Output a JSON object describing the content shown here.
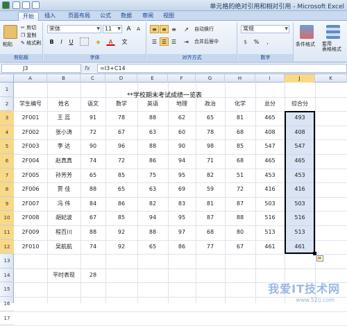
{
  "window": {
    "title": "单元格的绝对引用和相对引用 - Microsoft Excel"
  },
  "ribbon_tabs": [
    "开始",
    "插入",
    "页面布局",
    "公式",
    "数据",
    "审阅",
    "视图"
  ],
  "ribbon": {
    "clipboard": {
      "paste": "粘贴",
      "cut": "剪切",
      "copy": "复制",
      "format_painter": "格式刷",
      "label": "剪贴板"
    },
    "font": {
      "name": "宋体",
      "size": "11",
      "bold": "B",
      "italic": "I",
      "underline": "U",
      "grow": "A",
      "shrink": "A",
      "font_color": "A",
      "wen": "文",
      "label": "字体"
    },
    "alignment": {
      "wrap": "自动换行",
      "merge": "合并后居中",
      "label": "对齐方式"
    },
    "number": {
      "format": "常规",
      "percent": "%",
      "comma": ",",
      "label": "数字"
    },
    "styles": {
      "conditional": "条件格式",
      "table": "套用\n表格格式"
    }
  },
  "formula_bar": {
    "name_box": "J3",
    "fx": "fx",
    "formula": "=I3+C14"
  },
  "columns": [
    "A",
    "B",
    "C",
    "D",
    "E",
    "F",
    "G",
    "H",
    "I",
    "J",
    "K"
  ],
  "selected_column": "J",
  "rows": [
    "1",
    "2",
    "3",
    "4",
    "5",
    "6",
    "7",
    "8",
    "9",
    "10",
    "11",
    "12",
    "13",
    "14",
    "15",
    "16",
    "17"
  ],
  "sheet": {
    "title": "**学校期末考试成绩一览表",
    "headers": [
      "学生编号",
      "姓名",
      "语文",
      "数学",
      "英语",
      "地理",
      "政治",
      "化学",
      "总分",
      "综合分"
    ],
    "data": [
      [
        "2F001",
        "王 蕊",
        "91",
        "78",
        "88",
        "62",
        "65",
        "81",
        "465",
        "493"
      ],
      [
        "2F002",
        "张小涛",
        "72",
        "67",
        "63",
        "60",
        "78",
        "68",
        "408",
        "408"
      ],
      [
        "2F003",
        "李 达",
        "90",
        "96",
        "88",
        "90",
        "98",
        "85",
        "547",
        "547"
      ],
      [
        "2F004",
        "赵真真",
        "74",
        "72",
        "86",
        "94",
        "71",
        "68",
        "465",
        "465"
      ],
      [
        "2F005",
        "孙芳芳",
        "65",
        "85",
        "75",
        "95",
        "82",
        "51",
        "453",
        "453"
      ],
      [
        "2F006",
        "贾 佳",
        "88",
        "65",
        "63",
        "69",
        "59",
        "72",
        "416",
        "416"
      ],
      [
        "2F007",
        "冯 伟",
        "84",
        "86",
        "82",
        "83",
        "81",
        "87",
        "503",
        "503"
      ],
      [
        "2F008",
        "胡妃波",
        "67",
        "85",
        "94",
        "95",
        "87",
        "88",
        "516",
        "516"
      ],
      [
        "2F009",
        "程百川",
        "88",
        "92",
        "88",
        "97",
        "68",
        "80",
        "513",
        "513"
      ],
      [
        "2F010",
        "吴航航",
        "74",
        "92",
        "65",
        "86",
        "77",
        "67",
        "461",
        "461"
      ]
    ],
    "extra_label": "平时表现",
    "extra_value": "28"
  },
  "watermark": {
    "text": "我爱IT技术网",
    "url": "www.52ij.com"
  },
  "colors": {
    "selection_fill": "#bfcdeb",
    "header_highlight": "#f9d887",
    "ribbon_blue": "#15428b"
  }
}
